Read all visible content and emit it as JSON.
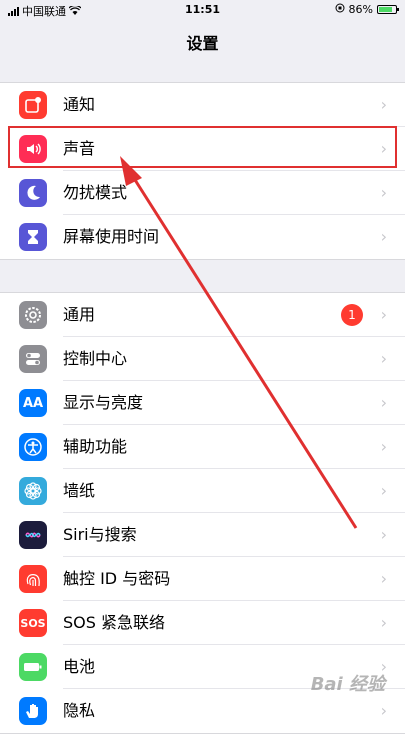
{
  "status_bar": {
    "carrier": "中国联通",
    "time": "11:51",
    "battery_percent": "86%",
    "battery_level": 0.86
  },
  "nav": {
    "title": "设置"
  },
  "group1": [
    {
      "label": "通知",
      "icon": "notifications-icon",
      "color": "#ff3b30"
    },
    {
      "label": "声音",
      "icon": "speaker-icon",
      "color": "#ff2d55"
    },
    {
      "label": "勿扰模式",
      "icon": "moon-icon",
      "color": "#5856d6"
    },
    {
      "label": "屏幕使用时间",
      "icon": "hourglass-icon",
      "color": "#5856d6"
    }
  ],
  "group2": [
    {
      "label": "通用",
      "icon": "gear-icon",
      "color": "#8e8e93",
      "badge": "1"
    },
    {
      "label": "控制中心",
      "icon": "switches-icon",
      "color": "#8e8e93"
    },
    {
      "label": "显示与亮度",
      "icon": "text-size-icon",
      "color": "#007aff",
      "glyph": "AA"
    },
    {
      "label": "辅助功能",
      "icon": "accessibility-icon",
      "color": "#007aff"
    },
    {
      "label": "墙纸",
      "icon": "flower-icon",
      "color": "#34aadc"
    },
    {
      "label": "Siri与搜索",
      "icon": "siri-icon",
      "color": "#1c1c3c"
    },
    {
      "label": "触控 ID 与密码",
      "icon": "fingerprint-icon",
      "color": "#ff3b30"
    },
    {
      "label": "SOS 紧急联络",
      "icon": "sos-icon",
      "color": "#ff3b30",
      "glyph": "SOS"
    },
    {
      "label": "电池",
      "icon": "battery-icon",
      "color": "#4cd964"
    },
    {
      "label": "隐私",
      "icon": "hand-icon",
      "color": "#007aff"
    }
  ],
  "chevron": "›",
  "watermark": "Bai 经验"
}
